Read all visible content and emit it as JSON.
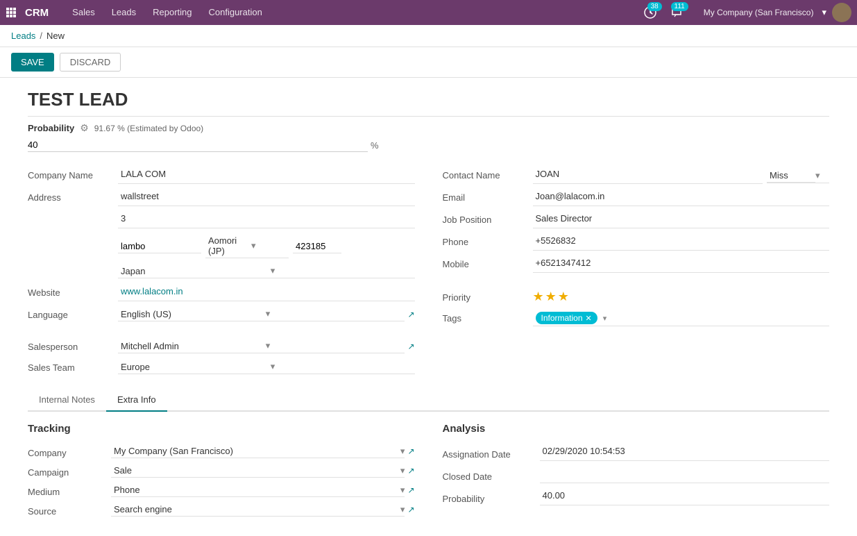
{
  "app": {
    "name": "CRM",
    "nav_items": [
      "Sales",
      "Leads",
      "Reporting",
      "Configuration"
    ],
    "badge_chat": "38",
    "badge_msg": "111",
    "company": "My Company (San Francisco)"
  },
  "breadcrumb": {
    "parent": "Leads",
    "current": "New"
  },
  "actions": {
    "save": "SAVE",
    "discard": "DISCARD"
  },
  "lead": {
    "title": "TEST LEAD",
    "probability_label": "Probability",
    "probability_estimated": "91.67 % (Estimated by Odoo)",
    "probability_value": "40",
    "probability_symbol": "%"
  },
  "form_left": {
    "company_name_label": "Company Name",
    "company_name_value": "LALA COM",
    "address_label": "Address",
    "address_street": "wallstreet",
    "address_number": "3",
    "address_city": "lambo",
    "address_state": "Aomori (JP)",
    "address_zip": "423185",
    "address_country": "Japan",
    "website_label": "Website",
    "website_value": "www.lalacom.in",
    "language_label": "Language",
    "language_value": "English (US)",
    "salesperson_label": "Salesperson",
    "salesperson_value": "Mitchell Admin",
    "sales_team_label": "Sales Team",
    "sales_team_value": "Europe"
  },
  "form_right": {
    "contact_name_label": "Contact Name",
    "contact_first": "JOAN",
    "contact_title": "Miss",
    "email_label": "Email",
    "email_value": "Joan@lalacom.in",
    "job_position_label": "Job Position",
    "job_position_value": "Sales Director",
    "phone_label": "Phone",
    "phone_value": "+5526832",
    "mobile_label": "Mobile",
    "mobile_value": "+6521347412",
    "priority_label": "Priority",
    "stars_filled": 3,
    "stars_total": 3,
    "tags_label": "Tags",
    "tag_name": "Information"
  },
  "tabs": {
    "items": [
      {
        "id": "internal-notes",
        "label": "Internal Notes"
      },
      {
        "id": "extra-info",
        "label": "Extra Info"
      }
    ],
    "active": "extra-info"
  },
  "tracking": {
    "title": "Tracking",
    "company_label": "Company",
    "company_value": "My Company (San Francisco)",
    "campaign_label": "Campaign",
    "campaign_value": "Sale",
    "medium_label": "Medium",
    "medium_value": "Phone",
    "source_label": "Source",
    "source_value": "Search engine"
  },
  "analysis": {
    "title": "Analysis",
    "assignation_date_label": "Assignation Date",
    "assignation_date_value": "02/29/2020 10:54:53",
    "closed_date_label": "Closed Date",
    "closed_date_value": "",
    "probability_label": "Probability",
    "probability_value": "40.00"
  }
}
